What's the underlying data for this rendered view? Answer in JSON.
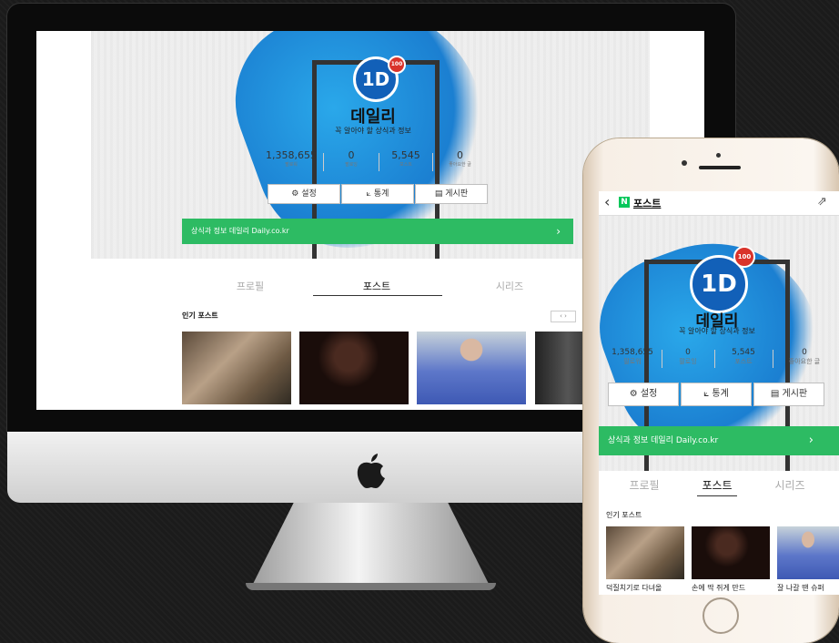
{
  "desktop": {
    "profile": {
      "badge": "100",
      "logo_text": "1D",
      "name": "데일리",
      "tagline": "꼭 알아야 할 상식과 정보",
      "stats": [
        {
          "value": "1,358,655",
          "label": "팔로워"
        },
        {
          "value": "0",
          "label": "팔로잉"
        },
        {
          "value": "5,545",
          "label": "포스트"
        },
        {
          "value": "0",
          "label": "좋아요한 글"
        }
      ],
      "buttons": [
        {
          "icon": "gear-icon",
          "glyph": "⚙",
          "label": "설정"
        },
        {
          "icon": "chart-icon",
          "glyph": "⟀",
          "label": "통계"
        },
        {
          "icon": "board-icon",
          "glyph": "▤",
          "label": "게시판"
        }
      ],
      "link_text": "상식과 정보 데일리 Daily.co.kr",
      "link_arrow": "›"
    },
    "tabs": [
      "프로필",
      "포스트",
      "시리즈"
    ],
    "active_tab": "포스트",
    "section_title": "인기 포스트",
    "pager": "‹ ›"
  },
  "mobile": {
    "header": {
      "back": "‹",
      "n_badge": "N",
      "title": "포스트",
      "share": "⇗"
    },
    "profile": {
      "badge": "100",
      "logo_text": "1D",
      "name": "데일리",
      "tagline": "꼭 알아야 할 상식과 정보",
      "stats": [
        {
          "value": "1,358,655",
          "label": "팔로워"
        },
        {
          "value": "0",
          "label": "팔로잉"
        },
        {
          "value": "5,545",
          "label": "포스트"
        },
        {
          "value": "0",
          "label": "좋아요한 글"
        }
      ],
      "buttons": [
        {
          "icon": "gear-icon",
          "glyph": "⚙",
          "label": "설정"
        },
        {
          "icon": "chart-icon",
          "glyph": "⟀",
          "label": "통계"
        },
        {
          "icon": "board-icon",
          "glyph": "▤",
          "label": "게시판"
        }
      ],
      "link_text": "상식과 정보 데일리 Daily.co.kr",
      "link_arrow": "›"
    },
    "tabs": [
      "프로필",
      "포스트",
      "시리즈"
    ],
    "active_tab": "포스트",
    "section_title": "인기 포스트",
    "post_captions": [
      "덕질치기로 다녀올",
      "손에 딱 쥐게 만드",
      "잘 나갈 땐 슈퍼"
    ]
  },
  "device": {
    "apple_logo": ""
  },
  "colors": {
    "accent_green": "#2dbb63",
    "cover_blue": "#1b8ee0",
    "logo_blue": "#1260b8",
    "badge_red": "#d9332b",
    "naver_green": "#03c75a"
  }
}
